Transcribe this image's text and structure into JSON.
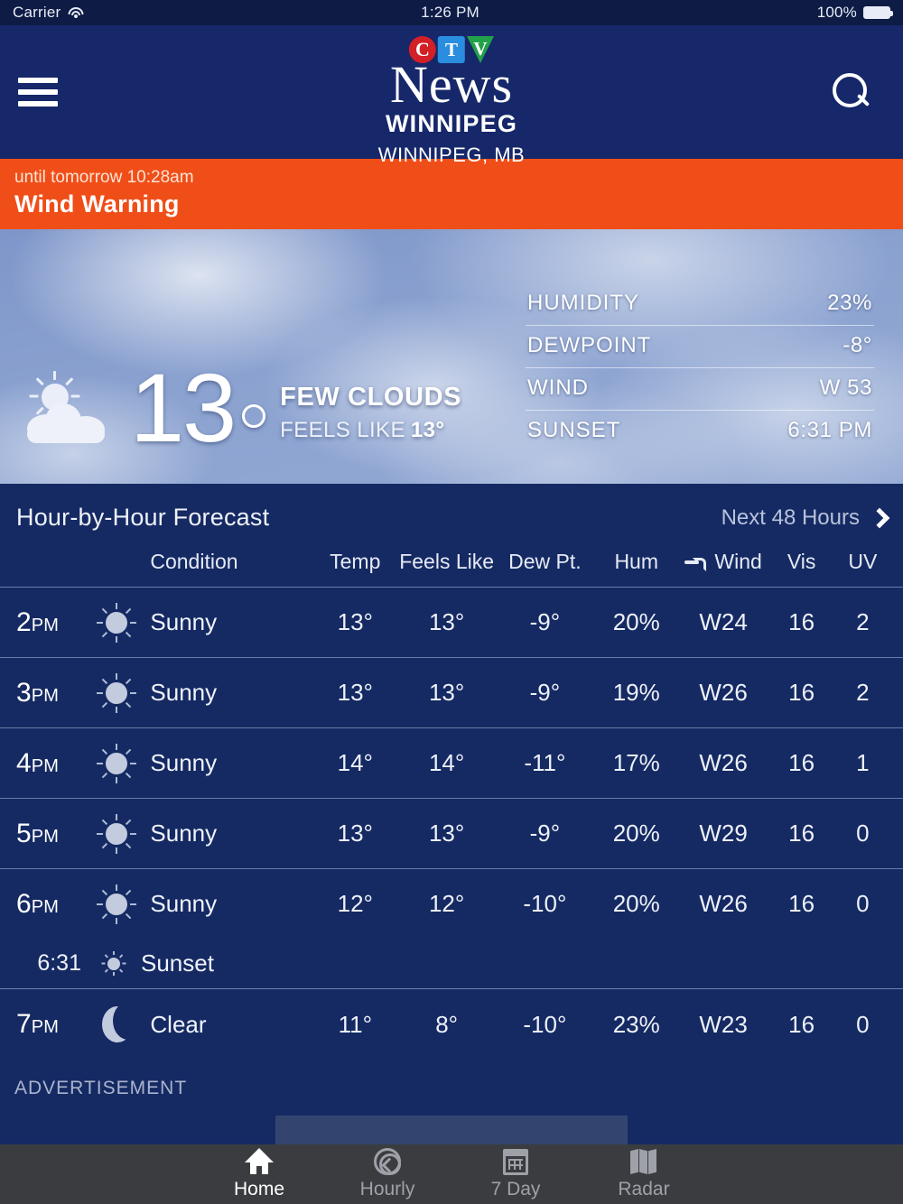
{
  "status_bar": {
    "carrier": "Carrier",
    "wifi_icon": "wifi-icon",
    "time": "1:26 PM",
    "battery_percent": "100%",
    "battery_icon": "battery-full-icon"
  },
  "header": {
    "menu_icon": "hamburger-menu-icon",
    "search_icon": "search-icon",
    "logo": {
      "c": "C",
      "t": "T",
      "v": "V"
    },
    "brand_news": "News",
    "brand_station": "WINNIPEG",
    "location": "WINNIPEG, MB"
  },
  "alert": {
    "until": "until tomorrow 10:28am",
    "title": "Wind Warning",
    "color": "#f04e18"
  },
  "current": {
    "icon": "sun-behind-cloud-icon",
    "temperature": "13",
    "degree_symbol": "°",
    "condition": "FEW CLOUDS",
    "feels_like_label": "FEELS LIKE",
    "feels_like_value": "13°",
    "stats": [
      {
        "label": "HUMIDITY",
        "value": "23%"
      },
      {
        "label": "DEWPOINT",
        "value": "-8°"
      },
      {
        "label": "WIND",
        "value": "W 53"
      },
      {
        "label": "SUNSET",
        "value": "6:31 PM"
      }
    ]
  },
  "hourly": {
    "title": "Hour-by-Hour Forecast",
    "next_link": "Next 48 Hours",
    "chevron_icon": "chevron-right-icon",
    "columns": {
      "time": "",
      "condition": "Condition",
      "temp": "Temp",
      "feels_like": "Feels Like",
      "dew_point": "Dew Pt.",
      "humidity": "Hum",
      "wind": "Wind",
      "wind_icon": "wind-icon",
      "visibility": "Vis",
      "uv": "UV"
    },
    "rows": [
      {
        "hour": "2",
        "meridiem": "PM",
        "icon": "sunny-icon",
        "condition": "Sunny",
        "temp": "13°",
        "feels_like": "13°",
        "dew_point": "-9°",
        "humidity": "20%",
        "wind": "W24",
        "visibility": "16",
        "uv": "2"
      },
      {
        "hour": "3",
        "meridiem": "PM",
        "icon": "sunny-icon",
        "condition": "Sunny",
        "temp": "13°",
        "feels_like": "13°",
        "dew_point": "-9°",
        "humidity": "19%",
        "wind": "W26",
        "visibility": "16",
        "uv": "2"
      },
      {
        "hour": "4",
        "meridiem": "PM",
        "icon": "sunny-icon",
        "condition": "Sunny",
        "temp": "14°",
        "feels_like": "14°",
        "dew_point": "-11°",
        "humidity": "17%",
        "wind": "W26",
        "visibility": "16",
        "uv": "1"
      },
      {
        "hour": "5",
        "meridiem": "PM",
        "icon": "sunny-icon",
        "condition": "Sunny",
        "temp": "13°",
        "feels_like": "13°",
        "dew_point": "-9°",
        "humidity": "20%",
        "wind": "W29",
        "visibility": "16",
        "uv": "0"
      },
      {
        "hour": "6",
        "meridiem": "PM",
        "icon": "sunny-icon",
        "condition": "Sunny",
        "temp": "12°",
        "feels_like": "12°",
        "dew_point": "-10°",
        "humidity": "20%",
        "wind": "W26",
        "visibility": "16",
        "uv": "0"
      },
      {
        "hour": "7",
        "meridiem": "PM",
        "icon": "clear-night-icon",
        "condition": "Clear",
        "temp": "11°",
        "feels_like": "8°",
        "dew_point": "-10°",
        "humidity": "23%",
        "wind": "W23",
        "visibility": "16",
        "uv": "0"
      }
    ],
    "sunset_event": {
      "time": "6:31",
      "label": "Sunset",
      "icon": "sunset-icon"
    }
  },
  "advertisement": {
    "label": "ADVERTISEMENT"
  },
  "tabbar": {
    "tabs": [
      {
        "label": "Home",
        "icon": "home-icon",
        "active": true
      },
      {
        "label": "Hourly",
        "icon": "clock-icon",
        "active": false
      },
      {
        "label": "7 Day",
        "icon": "calendar-icon",
        "active": false
      },
      {
        "label": "Radar",
        "icon": "map-icon",
        "active": false
      }
    ]
  }
}
